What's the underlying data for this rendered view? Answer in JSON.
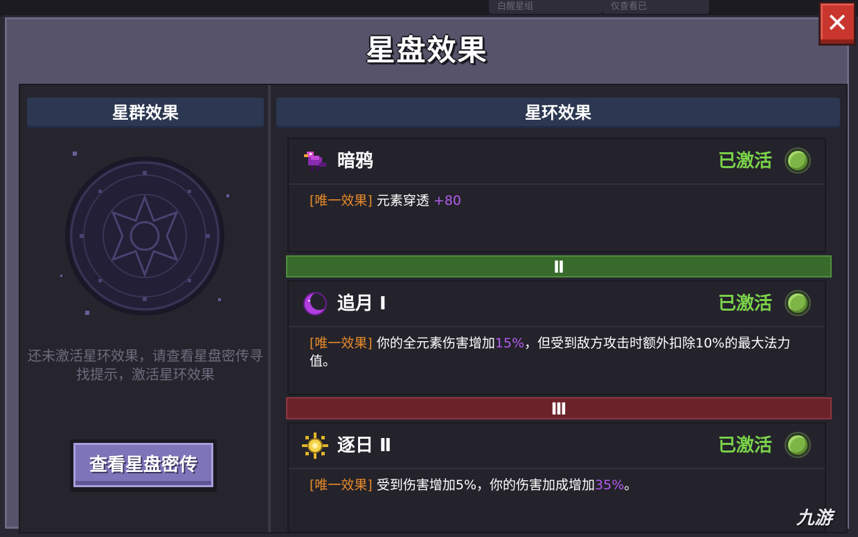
{
  "background": {
    "tabs": [
      "白醒星组",
      "仅查看已"
    ]
  },
  "panel": {
    "title": "星盘效果",
    "close_label": "✕"
  },
  "left": {
    "header": "星群效果",
    "hint": "还未激活星环效果，请查看星盘密传寻找提示，激活星环效果",
    "button": "查看星盘密传"
  },
  "right": {
    "header": "星环效果",
    "cards": [
      {
        "name": "暗鸦",
        "status": "已激活",
        "icon": "crow-icon",
        "tag": "[唯一效果]",
        "text": "元素穿透 ",
        "highlight": "+80",
        "tail": ""
      },
      {
        "name": "追月 Ⅰ",
        "status": "已激活",
        "icon": "crescent-moon-icon",
        "tag": "[唯一效果]",
        "text": "你的全元素伤害增加",
        "highlight": "15%",
        "tail": "，但受到敌方攻击时额外扣除10%的最大法力值。"
      },
      {
        "name": "逐日 Ⅱ",
        "status": "已激活",
        "icon": "sun-icon",
        "tag": "[唯一效果]",
        "text": "受到伤害增加5%，你的伤害加成增加",
        "highlight": "35%",
        "tail": "。"
      }
    ],
    "tiers": [
      "Ⅱ",
      "Ⅲ"
    ]
  },
  "watermark": "九游",
  "colors": {
    "active": "#7bd44a",
    "tag": "#e88a2a",
    "highlight": "#b65cf0",
    "tier_ii": "#386a2c",
    "tier_iii": "#6b2229"
  }
}
